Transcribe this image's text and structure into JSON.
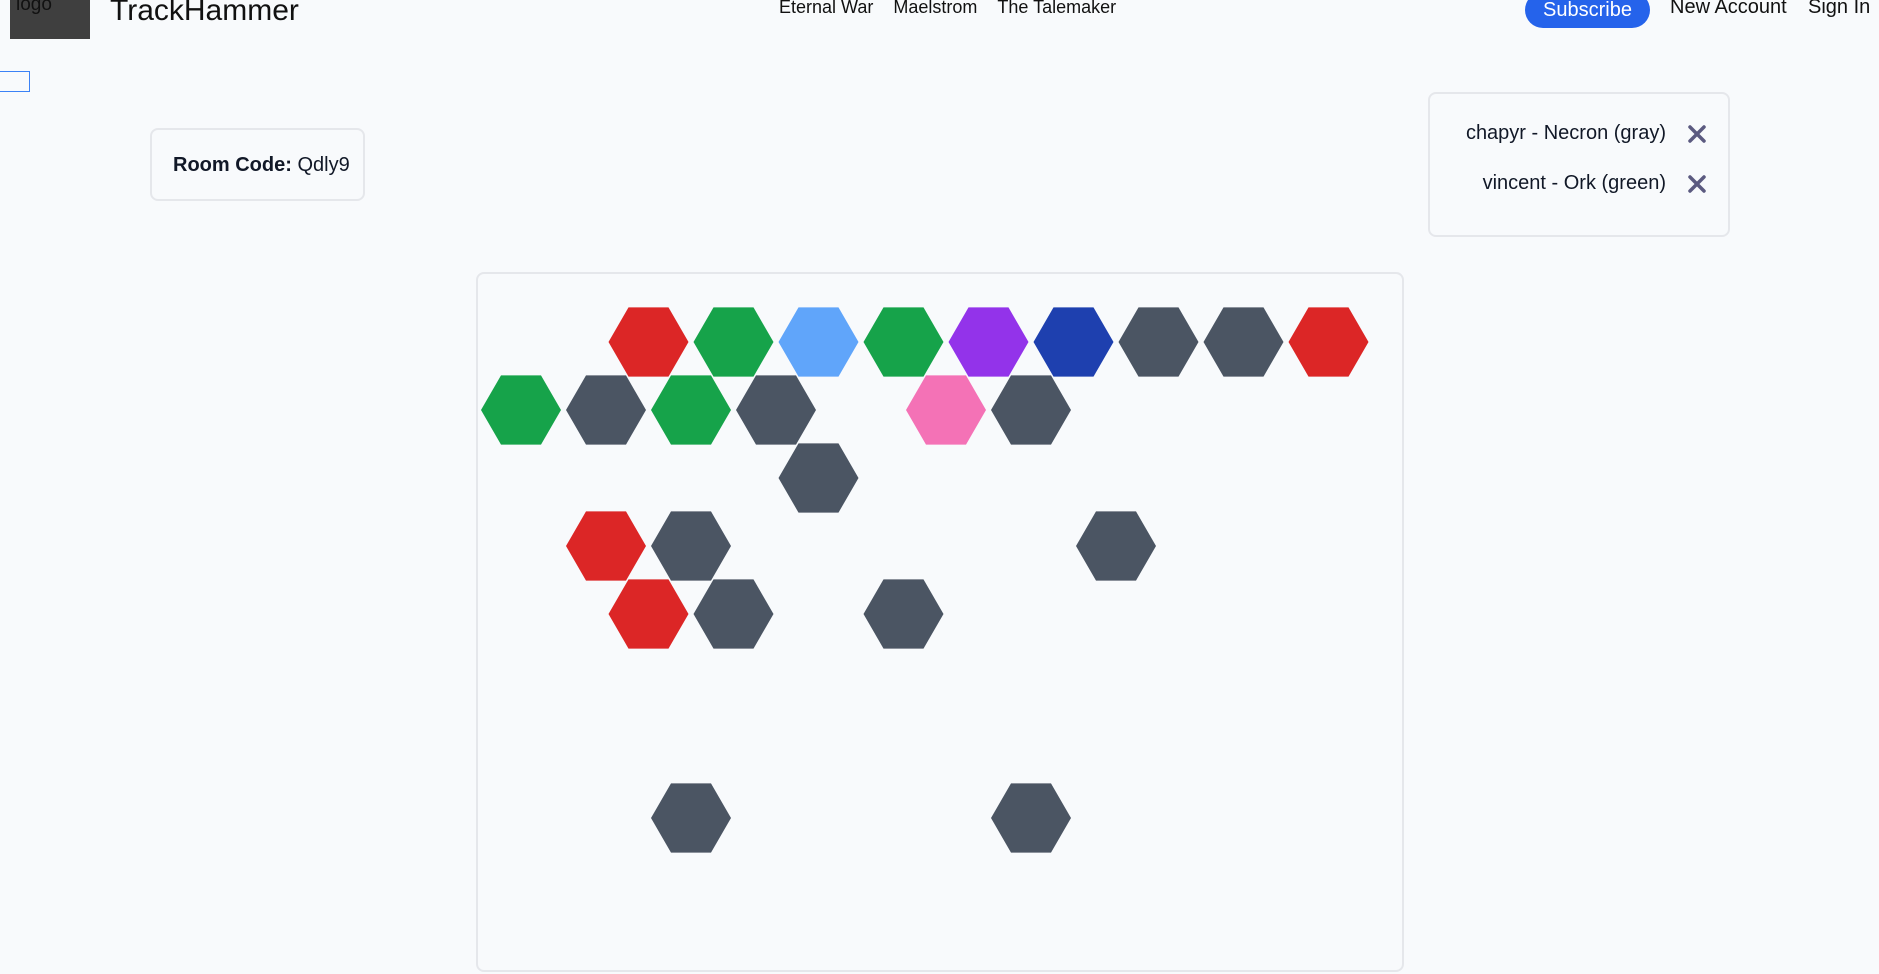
{
  "header": {
    "logo_alt": "logo",
    "brand": "TrackHammer",
    "nav": [
      "Eternal War",
      "Maelstrom",
      "The Talemaker"
    ],
    "subscribe": "Subscribe",
    "new_account": "New Account",
    "sign_in": "Sign In"
  },
  "room": {
    "label": "Room Code:",
    "code": "Qdly9"
  },
  "players": [
    {
      "text": "chapyr - Necron (gray)",
      "remove_icon": "close-icon"
    },
    {
      "text": "vincent - Ork (green)",
      "remove_icon": "close-icon"
    }
  ],
  "colors": {
    "red": "#dc2626",
    "green": "#16a34a",
    "light_blue": "#60a5fa",
    "purple": "#9333ea",
    "dark_blue": "#1e40af",
    "pink": "#f472b6",
    "gray": "#4b5563",
    "accent": "#2563eb",
    "remove_icon": "#5b5a80"
  },
  "board": {
    "hexes": [
      {
        "row": 0,
        "col": 1,
        "color": "red"
      },
      {
        "row": 0,
        "col": 2,
        "color": "green"
      },
      {
        "row": 0,
        "col": 3,
        "color": "light_blue"
      },
      {
        "row": 0,
        "col": 4,
        "color": "green"
      },
      {
        "row": 0,
        "col": 5,
        "color": "purple"
      },
      {
        "row": 0,
        "col": 6,
        "color": "dark_blue"
      },
      {
        "row": 0,
        "col": 7,
        "color": "gray"
      },
      {
        "row": 0,
        "col": 8,
        "color": "gray"
      },
      {
        "row": 0,
        "col": 9,
        "color": "red"
      },
      {
        "row": 1,
        "col": 0,
        "color": "green"
      },
      {
        "row": 1,
        "col": 1,
        "color": "gray"
      },
      {
        "row": 1,
        "col": 2,
        "color": "green"
      },
      {
        "row": 1,
        "col": 3,
        "color": "gray"
      },
      {
        "row": 1,
        "col": 5,
        "color": "pink"
      },
      {
        "row": 1,
        "col": 6,
        "color": "gray"
      },
      {
        "row": 2,
        "col": 3,
        "color": "gray"
      },
      {
        "row": 3,
        "col": 1,
        "color": "red"
      },
      {
        "row": 3,
        "col": 2,
        "color": "gray"
      },
      {
        "row": 3,
        "col": 7,
        "color": "gray"
      },
      {
        "row": 4,
        "col": 1,
        "color": "red"
      },
      {
        "row": 4,
        "col": 2,
        "color": "gray"
      },
      {
        "row": 4,
        "col": 4,
        "color": "gray"
      },
      {
        "row": 7,
        "col": 2,
        "color": "gray"
      },
      {
        "row": 7,
        "col": 6,
        "color": "gray"
      }
    ]
  }
}
